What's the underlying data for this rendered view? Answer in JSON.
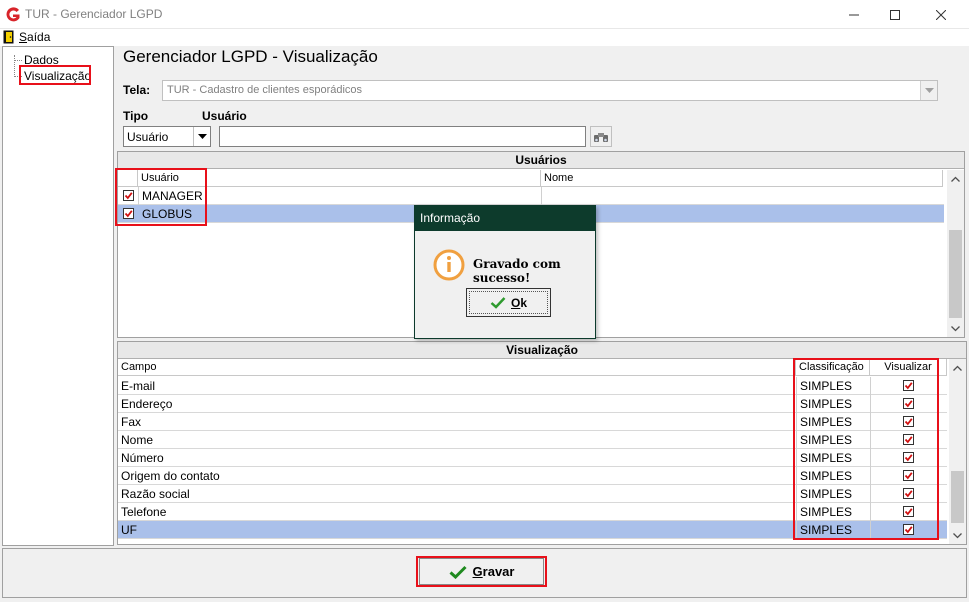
{
  "window": {
    "title": "TUR - Gerenciador LGPD"
  },
  "menu": {
    "exit_label": "Saída"
  },
  "tree": {
    "items": [
      {
        "label": "Dados"
      },
      {
        "label": "Visualização"
      }
    ]
  },
  "page": {
    "title": "Gerenciador LGPD - Visualização",
    "screen_label": "Tela:",
    "screen_value": "TUR - Cadastro de clientes esporádicos",
    "type_label": "Tipo",
    "type_value": "Usuário",
    "user_label": "Usuário",
    "user_value": ""
  },
  "users_grid": {
    "caption": "Usuários",
    "columns": [
      "Usuário",
      "Nome"
    ],
    "rows": [
      {
        "user": "MANAGER",
        "name": "",
        "checked": true
      },
      {
        "user": "GLOBUS",
        "name": "",
        "checked": true
      }
    ]
  },
  "view_grid": {
    "caption": "Visualização",
    "columns": [
      "Campo",
      "Classificação",
      "Visualizar"
    ],
    "rows": [
      {
        "field": "E-mail",
        "class": "SIMPLES",
        "visible": true
      },
      {
        "field": "Endereço",
        "class": "SIMPLES",
        "visible": true
      },
      {
        "field": "Fax",
        "class": "SIMPLES",
        "visible": true
      },
      {
        "field": "Nome",
        "class": "SIMPLES",
        "visible": true
      },
      {
        "field": "Número",
        "class": "SIMPLES",
        "visible": true
      },
      {
        "field": "Origem do contato",
        "class": "SIMPLES",
        "visible": true
      },
      {
        "field": "Razão social",
        "class": "SIMPLES",
        "visible": true
      },
      {
        "field": "Telefone",
        "class": "SIMPLES",
        "visible": true
      },
      {
        "field": "UF",
        "class": "SIMPLES",
        "visible": true
      }
    ]
  },
  "footer": {
    "save_label": "Gravar"
  },
  "dialog": {
    "title": "Informação",
    "message": "Gravado com sucesso!",
    "ok_label": "Ok"
  },
  "colors": {
    "selection": "#aac0ea",
    "highlight_box": "#e8101a",
    "dialog_title_bg": "#0d3b2c",
    "check_mark": "#d01010",
    "ok_check": "#2e9a2e"
  }
}
